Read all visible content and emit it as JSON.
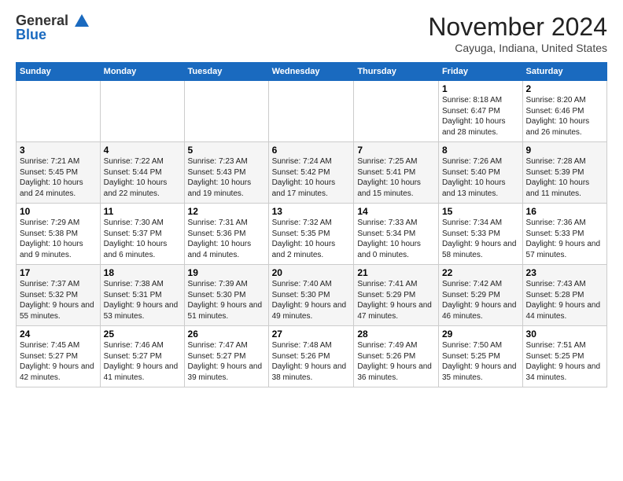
{
  "header": {
    "logo_line1": "General",
    "logo_line2": "Blue",
    "month": "November 2024",
    "location": "Cayuga, Indiana, United States"
  },
  "weekdays": [
    "Sunday",
    "Monday",
    "Tuesday",
    "Wednesday",
    "Thursday",
    "Friday",
    "Saturday"
  ],
  "weeks": [
    [
      {
        "day": "",
        "info": ""
      },
      {
        "day": "",
        "info": ""
      },
      {
        "day": "",
        "info": ""
      },
      {
        "day": "",
        "info": ""
      },
      {
        "day": "",
        "info": ""
      },
      {
        "day": "1",
        "info": "Sunrise: 8:18 AM\nSunset: 6:47 PM\nDaylight: 10 hours\nand 28 minutes."
      },
      {
        "day": "2",
        "info": "Sunrise: 8:20 AM\nSunset: 6:46 PM\nDaylight: 10 hours\nand 26 minutes."
      }
    ],
    [
      {
        "day": "3",
        "info": "Sunrise: 7:21 AM\nSunset: 5:45 PM\nDaylight: 10 hours\nand 24 minutes."
      },
      {
        "day": "4",
        "info": "Sunrise: 7:22 AM\nSunset: 5:44 PM\nDaylight: 10 hours\nand 22 minutes."
      },
      {
        "day": "5",
        "info": "Sunrise: 7:23 AM\nSunset: 5:43 PM\nDaylight: 10 hours\nand 19 minutes."
      },
      {
        "day": "6",
        "info": "Sunrise: 7:24 AM\nSunset: 5:42 PM\nDaylight: 10 hours\nand 17 minutes."
      },
      {
        "day": "7",
        "info": "Sunrise: 7:25 AM\nSunset: 5:41 PM\nDaylight: 10 hours\nand 15 minutes."
      },
      {
        "day": "8",
        "info": "Sunrise: 7:26 AM\nSunset: 5:40 PM\nDaylight: 10 hours\nand 13 minutes."
      },
      {
        "day": "9",
        "info": "Sunrise: 7:28 AM\nSunset: 5:39 PM\nDaylight: 10 hours\nand 11 minutes."
      }
    ],
    [
      {
        "day": "10",
        "info": "Sunrise: 7:29 AM\nSunset: 5:38 PM\nDaylight: 10 hours\nand 9 minutes."
      },
      {
        "day": "11",
        "info": "Sunrise: 7:30 AM\nSunset: 5:37 PM\nDaylight: 10 hours\nand 6 minutes."
      },
      {
        "day": "12",
        "info": "Sunrise: 7:31 AM\nSunset: 5:36 PM\nDaylight: 10 hours\nand 4 minutes."
      },
      {
        "day": "13",
        "info": "Sunrise: 7:32 AM\nSunset: 5:35 PM\nDaylight: 10 hours\nand 2 minutes."
      },
      {
        "day": "14",
        "info": "Sunrise: 7:33 AM\nSunset: 5:34 PM\nDaylight: 10 hours\nand 0 minutes."
      },
      {
        "day": "15",
        "info": "Sunrise: 7:34 AM\nSunset: 5:33 PM\nDaylight: 9 hours\nand 58 minutes."
      },
      {
        "day": "16",
        "info": "Sunrise: 7:36 AM\nSunset: 5:33 PM\nDaylight: 9 hours\nand 57 minutes."
      }
    ],
    [
      {
        "day": "17",
        "info": "Sunrise: 7:37 AM\nSunset: 5:32 PM\nDaylight: 9 hours\nand 55 minutes."
      },
      {
        "day": "18",
        "info": "Sunrise: 7:38 AM\nSunset: 5:31 PM\nDaylight: 9 hours\nand 53 minutes."
      },
      {
        "day": "19",
        "info": "Sunrise: 7:39 AM\nSunset: 5:30 PM\nDaylight: 9 hours\nand 51 minutes."
      },
      {
        "day": "20",
        "info": "Sunrise: 7:40 AM\nSunset: 5:30 PM\nDaylight: 9 hours\nand 49 minutes."
      },
      {
        "day": "21",
        "info": "Sunrise: 7:41 AM\nSunset: 5:29 PM\nDaylight: 9 hours\nand 47 minutes."
      },
      {
        "day": "22",
        "info": "Sunrise: 7:42 AM\nSunset: 5:29 PM\nDaylight: 9 hours\nand 46 minutes."
      },
      {
        "day": "23",
        "info": "Sunrise: 7:43 AM\nSunset: 5:28 PM\nDaylight: 9 hours\nand 44 minutes."
      }
    ],
    [
      {
        "day": "24",
        "info": "Sunrise: 7:45 AM\nSunset: 5:27 PM\nDaylight: 9 hours\nand 42 minutes."
      },
      {
        "day": "25",
        "info": "Sunrise: 7:46 AM\nSunset: 5:27 PM\nDaylight: 9 hours\nand 41 minutes."
      },
      {
        "day": "26",
        "info": "Sunrise: 7:47 AM\nSunset: 5:27 PM\nDaylight: 9 hours\nand 39 minutes."
      },
      {
        "day": "27",
        "info": "Sunrise: 7:48 AM\nSunset: 5:26 PM\nDaylight: 9 hours\nand 38 minutes."
      },
      {
        "day": "28",
        "info": "Sunrise: 7:49 AM\nSunset: 5:26 PM\nDaylight: 9 hours\nand 36 minutes."
      },
      {
        "day": "29",
        "info": "Sunrise: 7:50 AM\nSunset: 5:25 PM\nDaylight: 9 hours\nand 35 minutes."
      },
      {
        "day": "30",
        "info": "Sunrise: 7:51 AM\nSunset: 5:25 PM\nDaylight: 9 hours\nand 34 minutes."
      }
    ]
  ]
}
